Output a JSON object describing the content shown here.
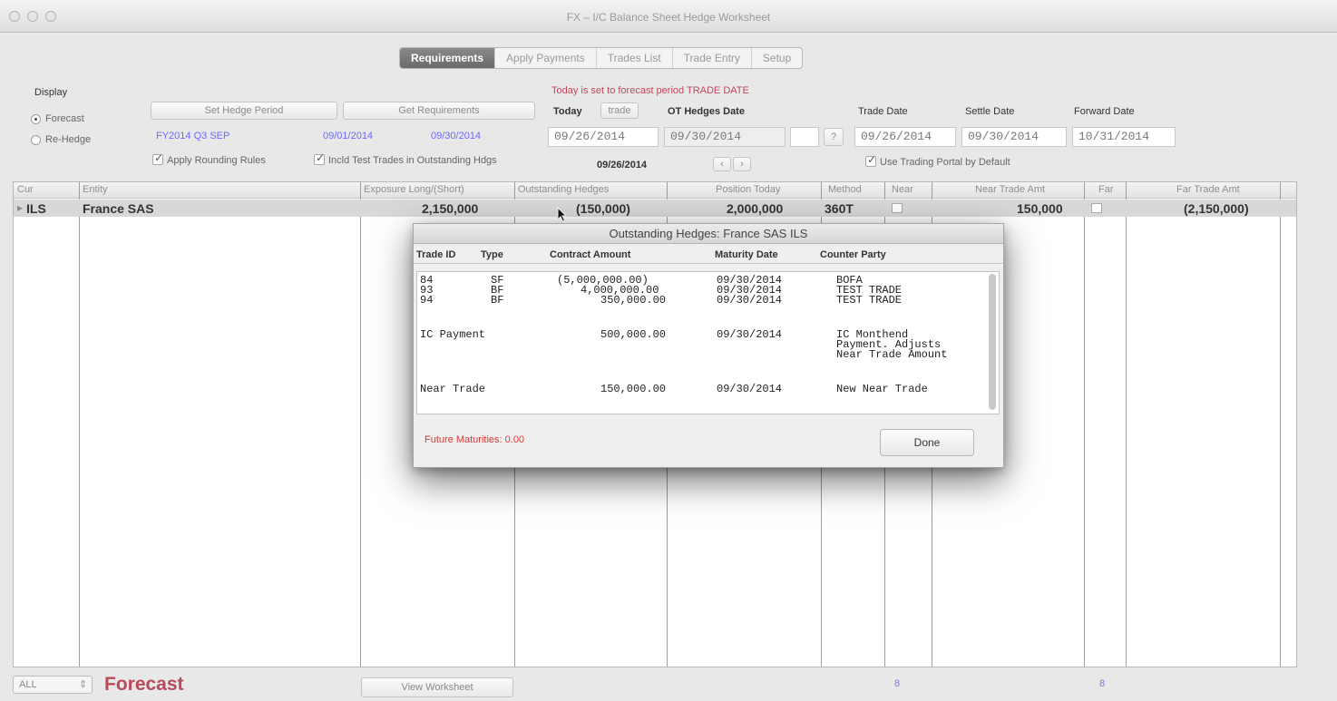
{
  "window": {
    "title": "FX – I/C Balance Sheet Hedge Worksheet"
  },
  "tabs": [
    {
      "label": "Requirements",
      "active": true
    },
    {
      "label": "Apply Payments",
      "active": false
    },
    {
      "label": "Trades List",
      "active": false
    },
    {
      "label": "Trade Entry",
      "active": false
    },
    {
      "label": "Setup",
      "active": false
    }
  ],
  "display": {
    "label": "Display",
    "options": [
      {
        "label": "Forecast",
        "selected": true
      },
      {
        "label": "Re-Hedge",
        "selected": false
      }
    ]
  },
  "hedge_period": {
    "set_button": "Set Hedge Period",
    "get_button": "Get Requirements",
    "period": "FY2014 Q3 SEP",
    "start": "09/01/2014",
    "end": "09/30/2014"
  },
  "checkboxes": {
    "apply_rounding": "Apply Rounding Rules",
    "incl_test_trades": "Incld Test Trades in Outstanding Hdgs",
    "use_trading_portal": "Use Trading Portal by Default"
  },
  "dates": {
    "notice": "Today is set to forecast period TRADE DATE",
    "today_label": "Today",
    "trade_button": "trade",
    "today_value": "09/26/2014",
    "ot_hedges_label": "OT Hedges Date",
    "ot_hedges_value": "09/30/2014",
    "help_button": "?",
    "incl_date": "09/26/2014",
    "stepper_prev": "‹",
    "stepper_next": "›",
    "trade_date_label": "Trade Date",
    "trade_date_value": "09/26/2014",
    "settle_date_label": "Settle Date",
    "settle_date_value": "09/30/2014",
    "forward_date_label": "Forward Date",
    "forward_date_value": "10/31/2014"
  },
  "grid": {
    "columns": [
      "Cur",
      "Entity",
      "Exposure Long/(Short)",
      "Outstanding Hedges",
      "Position Today",
      "Method",
      "Near",
      "Near Trade Amt",
      "Far",
      "Far Trade Amt"
    ],
    "rows": [
      {
        "cur": "ILS",
        "entity": "France SAS",
        "exposure": "2,150,000",
        "outstanding": "(150,000)",
        "position": "2,000,000",
        "method": "360T",
        "near_trade_amt": "150,000",
        "far_trade_amt": "(2,150,000)"
      }
    ]
  },
  "popup": {
    "title": "Outstanding Hedges: France SAS  ILS",
    "headers": [
      "Trade ID",
      "Type",
      "Contract Amount",
      "Maturity Date",
      "Counter Party"
    ],
    "lines": [
      {
        "id": "84",
        "type": "SF",
        "amount": "(5,000,000.00)",
        "maturity": "09/30/2014",
        "party": "BOFA"
      },
      {
        "id": "93",
        "type": "BF",
        "amount": "4,000,000.00",
        "maturity": "09/30/2014",
        "party": "TEST TRADE"
      },
      {
        "id": "94",
        "type": "BF",
        "amount": "350,000.00",
        "maturity": "09/30/2014",
        "party": "TEST TRADE"
      }
    ],
    "ic_payment": {
      "label": "IC Payment",
      "amount": "500,000.00",
      "maturity": "09/30/2014",
      "party_line1": "IC Monthend",
      "party_line2": "Payment. Adjusts",
      "party_line3": "Near Trade Amount"
    },
    "near_trade": {
      "label": "Near Trade",
      "amount": "150,000.00",
      "maturity": "09/30/2014",
      "party": "New Near Trade"
    },
    "future_maturities": "Future Maturities: 0.00",
    "done_button": "Done"
  },
  "bottom": {
    "filter_value": "ALL",
    "mode_label": "Forecast",
    "view_button": "View Worksheet",
    "near_count": "8",
    "far_count": "8"
  }
}
